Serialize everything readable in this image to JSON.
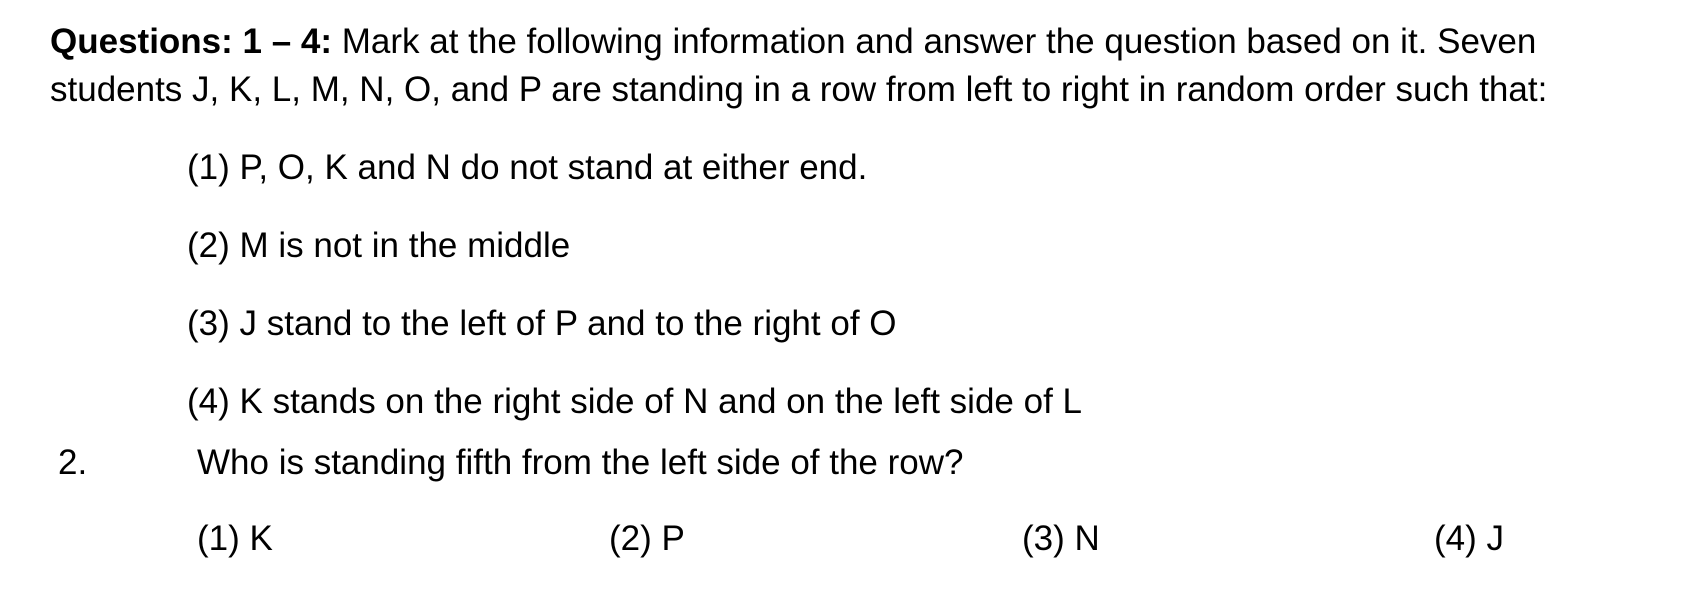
{
  "header": {
    "label": "Questions: 1 – 4:",
    "line1_text": " Mark at the following information and answer the question based on it. Seven",
    "line2_text": "students J, K, L, M, N, O, and P are standing in a row  from left to right in random order such that:"
  },
  "conditions": [
    "(1) P, O, K and N do not stand at either end.",
    "(2) M is not in the middle",
    "(3) J stand to the left of P and to the right of O",
    "(4) K stands on the right side of N and on the left side of L"
  ],
  "question": {
    "number": "2.",
    "text": "Who is standing fifth from the left side of the row?",
    "options": [
      "(1) K",
      "(2) P",
      "(3) N",
      "(4) J"
    ]
  }
}
